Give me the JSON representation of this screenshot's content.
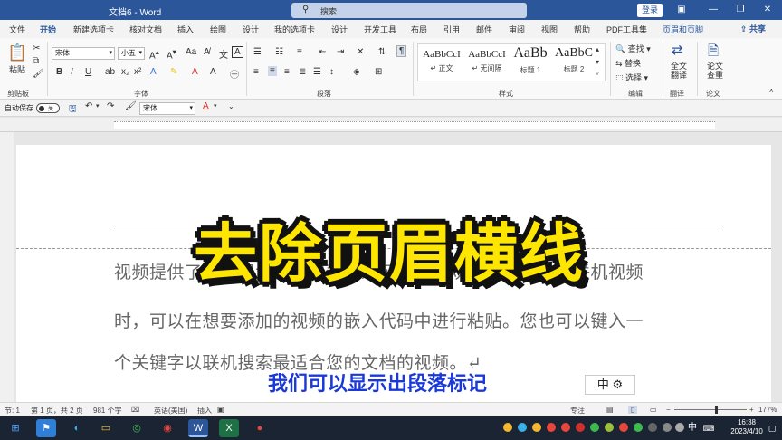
{
  "window": {
    "title": "文档6 - Word",
    "search_placeholder": "搜索",
    "login_label": "登录"
  },
  "menu_tabs": [
    "文件",
    "开始",
    "新建选项卡",
    "核对文档",
    "插入",
    "绘图",
    "设计",
    "我的选项卡",
    "设计",
    "开发工具",
    "布局",
    "引用",
    "邮件",
    "审阅",
    "视图",
    "帮助",
    "PDF工具集",
    "页眉和页脚"
  ],
  "active_tab": "开始",
  "share_label": "共享",
  "ribbon": {
    "clipboard": {
      "paste": "粘贴",
      "group": "剪贴板"
    },
    "font": {
      "name": "宋体",
      "size": "小五",
      "group": "字体"
    },
    "paragraph": {
      "group": "段落"
    },
    "styles": {
      "group": "样式",
      "items": [
        {
          "preview": "AaBbCcI",
          "name": "正文"
        },
        {
          "preview": "AaBbCcI",
          "name": "无间隔"
        },
        {
          "preview": "AaBb",
          "name": "标题 1"
        },
        {
          "preview": "AaBbC",
          "name": "标题 2"
        }
      ]
    },
    "editing": {
      "find": "查找",
      "replace": "替换",
      "select": "选择",
      "group": "编辑"
    },
    "translate": {
      "label": "全文翻译",
      "group": "翻译"
    },
    "paper": {
      "label": "论文查重",
      "group": "论文"
    }
  },
  "qat": {
    "autosave": "自动保存",
    "toggle_state": "关",
    "font": "宋体"
  },
  "document": {
    "lines": [
      "视频提供了功能强大的方法帮助您证明您的观点。当您单击联机视频",
      "时，可以在想要添加的视频的嵌入代码中进行粘贴。您也可以键入一",
      "个关键字以联机搜索最适合您的文档的视频。↵"
    ],
    "overlay_title": "去除页眉横线",
    "caption": "我们可以显示出段落标记",
    "ime": "中 ⚙"
  },
  "status_bar": {
    "section": "节: 1",
    "page": "第 1 页，共 2 页",
    "words": "981 个字",
    "lang": "英语(美国)",
    "mode": "插入",
    "focus": "专注",
    "zoom": "177%"
  },
  "taskbar": {
    "time": "16:38",
    "date": "2023/4/10",
    "ime": "中"
  },
  "colors": {
    "accent": "#2b579a",
    "overlay_yellow": "#ffe600",
    "caption_blue": "#1a39d6"
  }
}
